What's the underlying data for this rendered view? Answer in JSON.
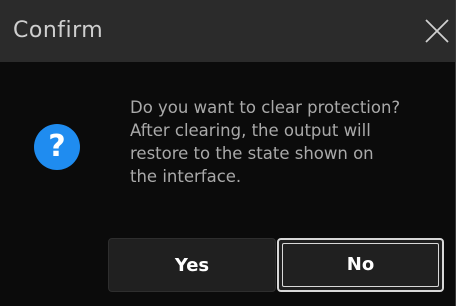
{
  "dialog": {
    "title": "Confirm",
    "close_icon": "close-icon",
    "question_icon": "question-icon",
    "question_glyph": "?",
    "message_lines": [
      "Do you want to clear protection?",
      "After clearing, the output will",
      "restore to the state shown on",
      "the interface."
    ],
    "buttons": {
      "yes_label": "Yes",
      "no_label": "No"
    }
  },
  "colors": {
    "titlebar_bg": "#2b2b2b",
    "body_bg": "#0b0b0b",
    "accent_icon": "#1f8cf0",
    "text_primary": "#ffffff",
    "text_secondary": "#a9a9a9",
    "focus_border": "#d8d8d8"
  }
}
